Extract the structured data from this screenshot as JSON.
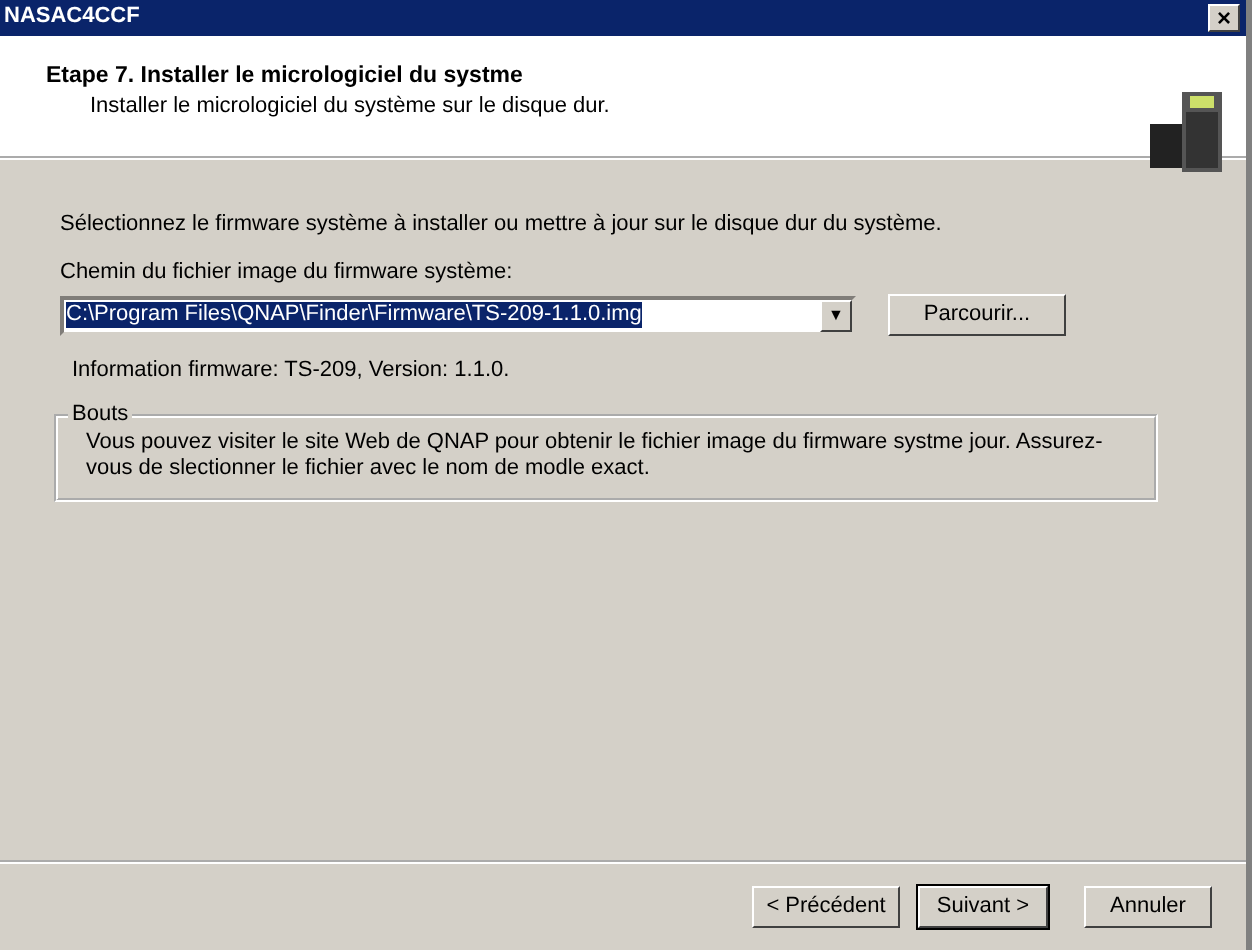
{
  "window": {
    "title": "NASAC4CCF",
    "close": "×"
  },
  "header": {
    "title": "Etape 7. Installer le micrologiciel du systme",
    "subtitle": "Installer le micrologiciel du système sur le disque dur."
  },
  "intro": "Sélectionnez le firmware système à installer ou mettre à jour sur le disque dur du système.",
  "path_label": "Chemin du fichier image du firmware système:",
  "path_field": {
    "value": "C:\\Program Files\\QNAP\\Finder\\Firmware\\TS-209-1.1.0.img",
    "text_selected": true,
    "arrow": "▼"
  },
  "browse_button": "Parcourir...",
  "info": "Information firmware: TS-209, Version: 1.1.0.",
  "tips": {
    "title": "Bouts",
    "text": "Vous pouvez visiter le site Web de QNAP pour obtenir le fichier image du firmware systme  jour.  Assurez-vous de slectionner le fichier avec le nom de modle exact."
  },
  "buttons": [
    {
      "label": "< Précédent",
      "default": false
    },
    {
      "label": "Suivant >",
      "default": true
    },
    {
      "label": "Annuler",
      "default": false
    }
  ]
}
